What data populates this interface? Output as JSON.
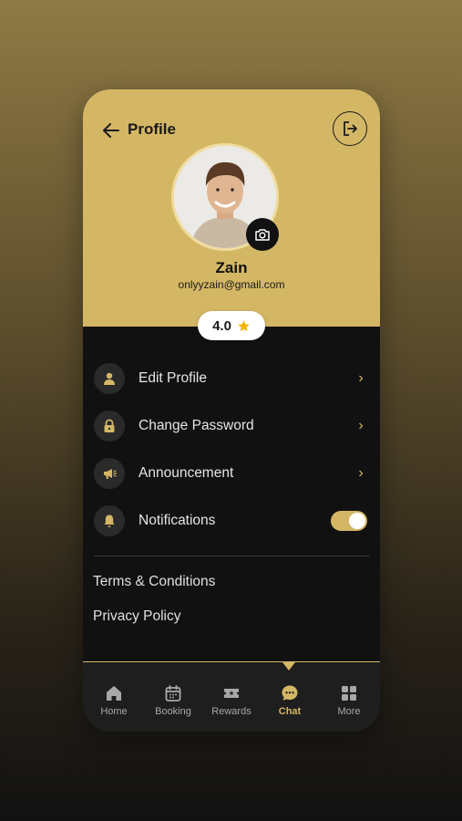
{
  "header": {
    "title": "Profile"
  },
  "profile": {
    "name": "Zain",
    "email": "onlyyzain@gmail.com",
    "rating": "4.0"
  },
  "menu": {
    "items": [
      {
        "label": "Edit Profile",
        "icon": "user-icon"
      },
      {
        "label": "Change Password",
        "icon": "lock-icon"
      },
      {
        "label": "Announcement",
        "icon": "megaphone-icon"
      },
      {
        "label": "Notifications",
        "icon": "bell-icon",
        "toggle_on": true
      }
    ]
  },
  "links": {
    "terms": "Terms & Conditions",
    "privacy": "Privacy Policy"
  },
  "nav": {
    "items": [
      {
        "label": "Home",
        "icon": "home-icon"
      },
      {
        "label": "Booking",
        "icon": "calendar-icon"
      },
      {
        "label": "Rewards",
        "icon": "ticket-icon"
      },
      {
        "label": "Chat",
        "icon": "chat-icon",
        "active": true
      },
      {
        "label": "More",
        "icon": "grid-icon"
      }
    ]
  },
  "colors": {
    "accent": "#d4b765",
    "background": "#111111",
    "item_bg": "#2a2a2a"
  }
}
